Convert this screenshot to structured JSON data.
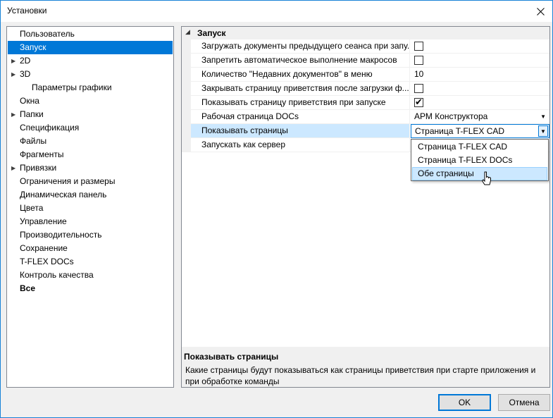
{
  "window": {
    "title": "Установки"
  },
  "tree": {
    "items": [
      {
        "label": "Пользователь",
        "indent": 0,
        "expander": false,
        "selected": false,
        "bold": false
      },
      {
        "label": "Запуск",
        "indent": 0,
        "expander": false,
        "selected": true,
        "bold": false
      },
      {
        "label": "2D",
        "indent": 0,
        "expander": true,
        "selected": false,
        "bold": false
      },
      {
        "label": "3D",
        "indent": 0,
        "expander": true,
        "selected": false,
        "bold": false
      },
      {
        "label": "Параметры графики",
        "indent": 1,
        "expander": false,
        "selected": false,
        "bold": false
      },
      {
        "label": "Окна",
        "indent": 0,
        "expander": false,
        "selected": false,
        "bold": false
      },
      {
        "label": "Папки",
        "indent": 0,
        "expander": true,
        "selected": false,
        "bold": false
      },
      {
        "label": "Спецификация",
        "indent": 0,
        "expander": false,
        "selected": false,
        "bold": false
      },
      {
        "label": "Файлы",
        "indent": 0,
        "expander": false,
        "selected": false,
        "bold": false
      },
      {
        "label": "Фрагменты",
        "indent": 0,
        "expander": false,
        "selected": false,
        "bold": false
      },
      {
        "label": "Привязки",
        "indent": 0,
        "expander": true,
        "selected": false,
        "bold": false
      },
      {
        "label": "Ограничения и размеры",
        "indent": 0,
        "expander": false,
        "selected": false,
        "bold": false
      },
      {
        "label": "Динамическая панель",
        "indent": 0,
        "expander": false,
        "selected": false,
        "bold": false
      },
      {
        "label": "Цвета",
        "indent": 0,
        "expander": false,
        "selected": false,
        "bold": false
      },
      {
        "label": "Управление",
        "indent": 0,
        "expander": false,
        "selected": false,
        "bold": false
      },
      {
        "label": "Производительность",
        "indent": 0,
        "expander": false,
        "selected": false,
        "bold": false
      },
      {
        "label": "Сохранение",
        "indent": 0,
        "expander": false,
        "selected": false,
        "bold": false
      },
      {
        "label": "T-FLEX DOCs",
        "indent": 0,
        "expander": false,
        "selected": false,
        "bold": false
      },
      {
        "label": "Контроль качества",
        "indent": 0,
        "expander": false,
        "selected": false,
        "bold": false
      },
      {
        "label": "Все",
        "indent": 0,
        "expander": false,
        "selected": false,
        "bold": true
      }
    ]
  },
  "properties": {
    "category": "Запуск",
    "rows": [
      {
        "name": "Загружать документы предыдущего сеанса при запу...",
        "type": "checkbox",
        "checked": false,
        "value": ""
      },
      {
        "name": "Запретить автоматическое выполнение макросов",
        "type": "checkbox",
        "checked": false,
        "value": ""
      },
      {
        "name": "Количество \"Недавних документов\" в меню",
        "type": "text",
        "checked": false,
        "value": "10"
      },
      {
        "name": "Закрывать страницу приветствия после загрузки ф...",
        "type": "checkbox",
        "checked": false,
        "value": ""
      },
      {
        "name": "Показывать страницу приветствия при запуске",
        "type": "checkbox",
        "checked": true,
        "value": ""
      },
      {
        "name": "Рабочая страница DOCs",
        "type": "dropdown",
        "checked": false,
        "value": "АРМ Конструктора"
      },
      {
        "name": "Показывать страницы",
        "type": "combo-open",
        "checked": false,
        "value": "Страница T-FLEX CAD"
      },
      {
        "name": "Запускать как сервер",
        "type": "text",
        "checked": false,
        "value": ""
      }
    ],
    "dropdown_options": [
      "Страница T-FLEX CAD",
      "Страница T-FLEX DOCs",
      "Обе страницы"
    ],
    "dropdown_hover": "Обе страницы"
  },
  "description": {
    "title": "Показывать страницы",
    "text": "Какие страницы будут показываться как страницы приветствия при старте приложения и при обработке команды"
  },
  "buttons": {
    "ok": "OK",
    "cancel": "Отмена"
  },
  "colors": {
    "accent": "#0078d7",
    "selection_light": "#cce8ff"
  }
}
